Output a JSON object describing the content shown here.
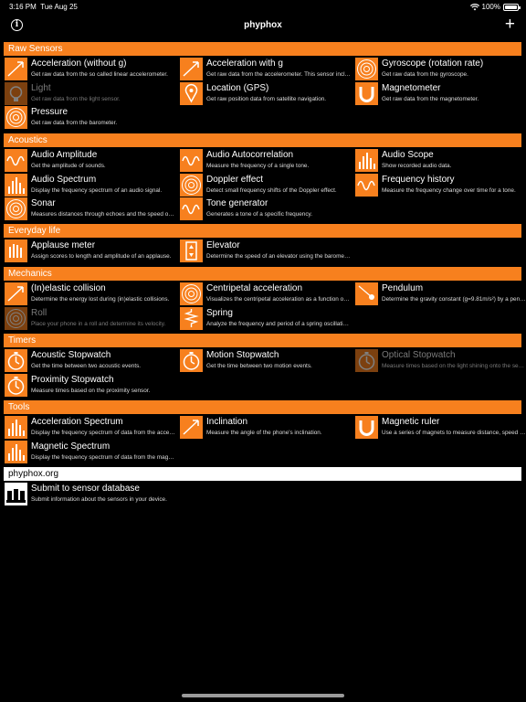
{
  "status": {
    "time": "3:16 PM",
    "date": "Tue Aug 25",
    "battery": "100%"
  },
  "nav": {
    "title": "phyphox"
  },
  "sections": [
    {
      "label": "Raw Sensors",
      "items": [
        {
          "title": "Acceleration (without g)",
          "desc": "Get raw data from the so called linear accelerometer.",
          "icon": "acceleration-icon",
          "enabled": true
        },
        {
          "title": "Acceleration with g",
          "desc": "Get raw data from the accelerometer. This sensor includes gravity.",
          "icon": "acceleration-with-g-icon",
          "enabled": true
        },
        {
          "title": "Gyroscope (rotation rate)",
          "desc": "Get raw data from the gyroscope.",
          "icon": "gyroscope-icon",
          "enabled": true
        },
        {
          "title": "Light",
          "desc": "Get raw data from the light sensor.",
          "icon": "light-bulb-icon",
          "enabled": false
        },
        {
          "title": "Location (GPS)",
          "desc": "Get raw position data from satellite navigation.",
          "icon": "location-icon",
          "enabled": true
        },
        {
          "title": "Magnetometer",
          "desc": "Get raw data from the magnetometer.",
          "icon": "magnet-icon",
          "enabled": true
        },
        {
          "title": "Pressure",
          "desc": "Get raw data from the barometer.",
          "icon": "pressure-gauge-icon",
          "enabled": true
        }
      ]
    },
    {
      "label": "Acoustics",
      "items": [
        {
          "title": "Audio Amplitude",
          "desc": "Get the amplitude of sounds.",
          "icon": "waveform-icon",
          "enabled": true
        },
        {
          "title": "Audio Autocorrelation",
          "desc": "Measure the frequency of a single tone.",
          "icon": "autocorrelation-icon",
          "enabled": true
        },
        {
          "title": "Audio Scope",
          "desc": "Show recorded audio data.",
          "icon": "audio-scope-icon",
          "enabled": true
        },
        {
          "title": "Audio Spectrum",
          "desc": "Display the frequency spectrum of an audio signal.",
          "icon": "spectrum-icon",
          "enabled": true
        },
        {
          "title": "Doppler effect",
          "desc": "Detect small frequency shifts of the Doppler effect.",
          "icon": "doppler-icon",
          "enabled": true
        },
        {
          "title": "Frequency history",
          "desc": "Measure the frequency change over time for a tone.",
          "icon": "frequency-history-icon",
          "enabled": true
        },
        {
          "title": "Sonar",
          "desc": "Measures distances through echoes and the speed of sound.",
          "icon": "sonar-icon",
          "enabled": true
        },
        {
          "title": "Tone generator",
          "desc": "Generates a tone of a specific frequency.",
          "icon": "speaker-icon",
          "enabled": true
        }
      ]
    },
    {
      "label": "Everyday life",
      "items": [
        {
          "title": "Applause meter",
          "desc": "Assign scores to length and amplitude of an applause.",
          "icon": "clapping-hands-icon",
          "enabled": true
        },
        {
          "title": "Elevator",
          "desc": "Determine the speed of an elevator using the barometer.",
          "icon": "elevator-icon",
          "enabled": true
        }
      ]
    },
    {
      "label": "Mechanics",
      "items": [
        {
          "title": "(In)elastic collision",
          "desc": "Determine the energy lost during (in)elastic collisions.",
          "icon": "collision-icon",
          "enabled": true
        },
        {
          "title": "Centripetal acceleration",
          "desc": "Visualizes the centripetal acceleration as a function of rotation.",
          "icon": "centripetal-icon",
          "enabled": true
        },
        {
          "title": "Pendulum",
          "desc": "Determine the gravity constant (g=9.81m/s²) by a pendulum.",
          "icon": "pendulum-icon",
          "enabled": true
        },
        {
          "title": "Roll",
          "desc": "Place your phone in a roll and determine its velocity.",
          "icon": "roll-icon",
          "enabled": false
        },
        {
          "title": "Spring",
          "desc": "Analyze the frequency and period of a spring oscillation.",
          "icon": "spring-icon",
          "enabled": true
        }
      ]
    },
    {
      "label": "Timers",
      "items": [
        {
          "title": "Acoustic Stopwatch",
          "desc": "Get the time between two acoustic events.",
          "icon": "acoustic-stopwatch-icon",
          "enabled": true
        },
        {
          "title": "Motion Stopwatch",
          "desc": "Get the time between two motion events.",
          "icon": "motion-stopwatch-icon",
          "enabled": true
        },
        {
          "title": "Optical Stopwatch",
          "desc": "Measure times based on the light shining onto the sensor.",
          "icon": "optical-stopwatch-icon",
          "enabled": false
        },
        {
          "title": "Proximity Stopwatch",
          "desc": "Measure times based on the proximity sensor.",
          "icon": "proximity-stopwatch-icon",
          "enabled": true
        }
      ]
    },
    {
      "label": "Tools",
      "items": [
        {
          "title": "Acceleration Spectrum",
          "desc": "Display the frequency spectrum of data from the accelerometer.",
          "icon": "acceleration-spectrum-icon",
          "enabled": true
        },
        {
          "title": "Inclination",
          "desc": "Measure the angle of the phone's inclination.",
          "icon": "inclination-icon",
          "enabled": true
        },
        {
          "title": "Magnetic ruler",
          "desc": "Use a series of magnets to measure distance, speed and acceleration.",
          "icon": "magnetic-ruler-icon",
          "enabled": true
        },
        {
          "title": "Magnetic Spectrum",
          "desc": "Display the frequency spectrum of data from the magnetometer.",
          "icon": "magnetic-spectrum-icon",
          "enabled": true
        }
      ]
    },
    {
      "label": "phyphox.org",
      "items": [
        {
          "title": "Submit to sensor database",
          "desc": "Submit information about the sensors in your device.",
          "icon": "sensor-database-icon",
          "enabled": true
        }
      ]
    }
  ]
}
